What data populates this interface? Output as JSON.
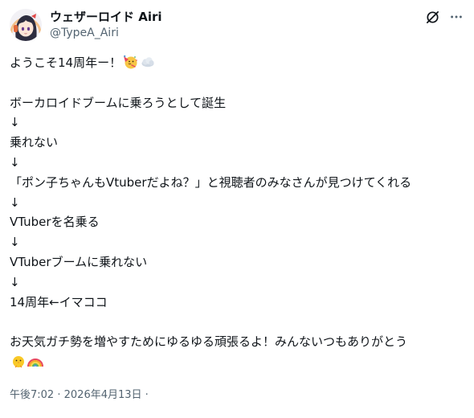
{
  "author": {
    "display_name": "ウェザーロイド Airi",
    "handle": "@TypeA_Airi"
  },
  "icons": {
    "avatar": "avatar",
    "grok": "grok-icon",
    "more": "more-icon",
    "party": "party-face-emoji",
    "cloud": "cloud-emoji",
    "chick": "chick-emoji",
    "rainbow": "rainbow-emoji"
  },
  "post": {
    "lines": [
      "ようこそ14周年ー！",
      "",
      "ボーカロイドブームに乗ろうとして誕生",
      "↓",
      "乗れない",
      "↓",
      "「ポン子ちゃんもVtuberだよね？」と視聴者のみなさんが見つけてくれる",
      "↓",
      "VTuberを名乗る",
      "↓",
      "VTuberブームに乗れない",
      "↓",
      "14周年←イマココ",
      "",
      "お天気ガチ勢を増やすためにゆるゆる頑張るよ！みんないつもありがとう"
    ]
  },
  "meta": {
    "time": "午後7:02",
    "separator": "·",
    "date": "2026年4月13日",
    "trailing": "·"
  },
  "colors": {
    "text": "#0f1419",
    "muted": "#536471",
    "background": "#ffffff"
  }
}
